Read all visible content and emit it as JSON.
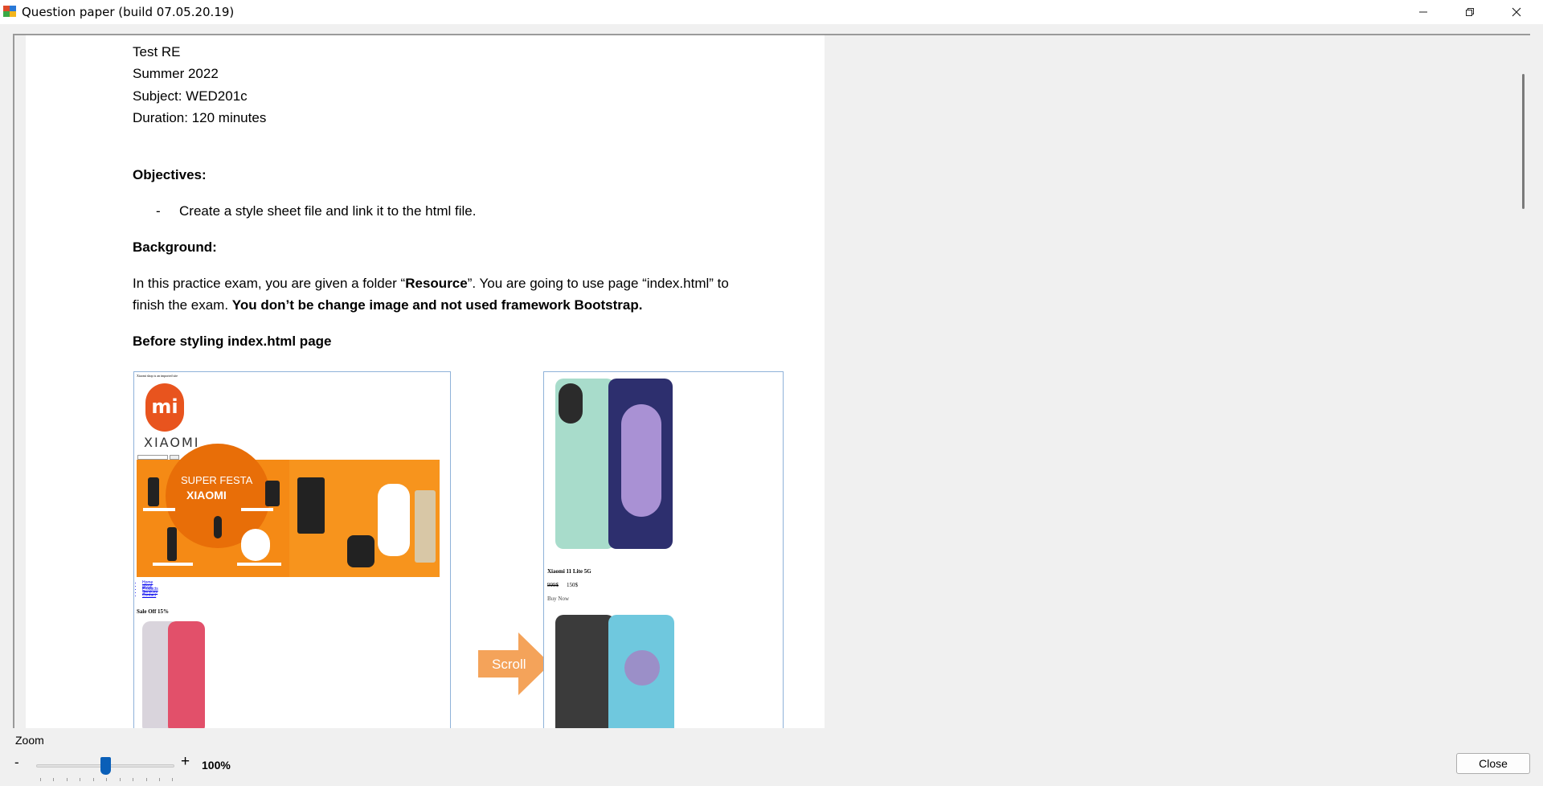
{
  "window": {
    "title": "Question paper (build 07.05.20.19)",
    "icon": "app-icon",
    "controls": {
      "minimize": "minimize-icon",
      "restore": "restore-icon",
      "close": "close-icon"
    }
  },
  "document": {
    "header_lines": [
      "Test RE",
      "Summer 2022",
      "Subject: WED201c",
      "Duration: 120 minutes"
    ],
    "objectives_heading": "Objectives:",
    "objective_bullet": "-",
    "objective_item": "Create a style sheet file and link it to the html file.",
    "background_heading": "Background:",
    "background_p1_start": "In this practice exam, you are given a folder “",
    "background_p1_bold": "Resource",
    "background_p1_end": "”. You are going to use page “index.html”  to",
    "background_p2_start": "finish the exam. ",
    "background_p2_bold": "You don’t be change image and not used framework Bootstrap.",
    "before_heading": "Before styling index.html page",
    "arrow_label": "Scroll",
    "shot1": {
      "tiny_header": "Xiaomi shop is an imported site",
      "logo_text": "mi",
      "brand_word": "XIAOMI",
      "banner_line1": "SUPER FESTA",
      "banner_line2": "XIAOMI",
      "nav_items": [
        "Home",
        "about",
        "Products",
        "Services",
        "Contact"
      ],
      "sale_heading": "Sale Off 15%"
    },
    "shot2": {
      "product_name": "Xiaomi 11 Lite 5G",
      "old_price": "999$",
      "new_price": "150$",
      "buy_link": "Buy Now"
    }
  },
  "footer": {
    "zoom_label": "Zoom",
    "zoom_minus": "-",
    "zoom_plus": "+",
    "zoom_value": "100%",
    "zoom_level_percent": 100,
    "close_label": "Close"
  }
}
